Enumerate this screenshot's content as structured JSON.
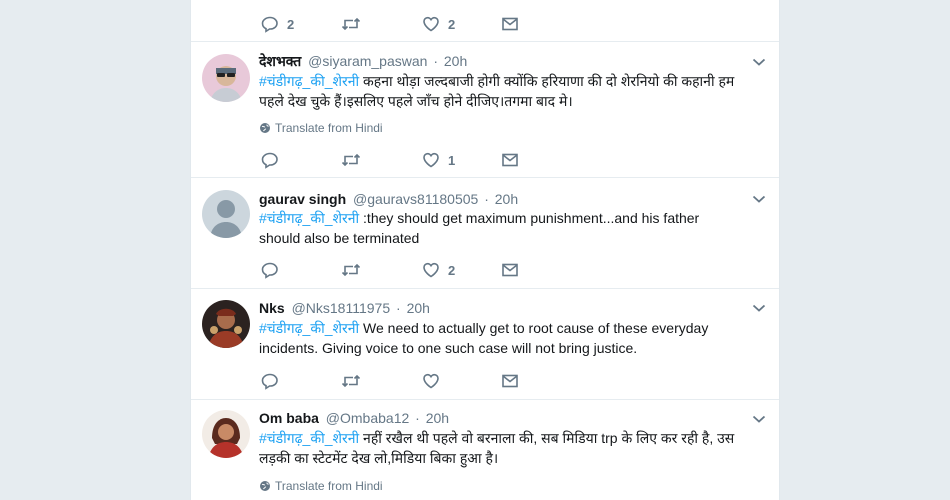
{
  "tweets": [
    {
      "id": "t0",
      "reply_count": "2",
      "retweet_count": "",
      "like_count": "2"
    },
    {
      "id": "t1",
      "name": "देशभक्त",
      "handle": "@siyaram_paswan",
      "time": "20h",
      "hashtag": "#चंडीगढ़_की_शेरनी",
      "text": " कहना थोड़ा जल्दबाजी होगी क्योंकि हरियाणा की दो शेरनियो की कहानी हम पहले देख चुके हैं।इसलिए पहले जाँच होने दीजिए।तगमा बाद मे।",
      "translate": "Translate from Hindi",
      "reply_count": "",
      "retweet_count": "",
      "like_count": "1"
    },
    {
      "id": "t2",
      "name": "gaurav singh",
      "handle": "@gauravs81180505",
      "time": "20h",
      "hashtag": "#चंडीगढ़_की_शेरनी",
      "text": " :they should get maximum punishment...and his father should also be terminated",
      "reply_count": "",
      "retweet_count": "",
      "like_count": "2"
    },
    {
      "id": "t3",
      "name": "Nks",
      "handle": "@Nks18111975",
      "time": "20h",
      "hashtag": "#चंडीगढ़_की_शेरनी",
      "text": " We need to actually get to root cause of these everyday incidents. Giving voice to one such case will not bring justice.",
      "reply_count": "",
      "retweet_count": "",
      "like_count": ""
    },
    {
      "id": "t4",
      "name": "Om baba",
      "handle": "@Ombaba12",
      "time": "20h",
      "hashtag": "#चंडीगढ़_की_शेरनी",
      "text": " नहीं रखैल थी पहले वो बरनाला की, सब मिडिया trp के लिए कर रही है, उस लड़की का स्टेटमेंट देख लो,मिडिया बिका हुआ है।",
      "translate": "Translate from Hindi"
    }
  ],
  "separator": "·",
  "icons": {
    "reply": "reply-icon",
    "retweet": "retweet-icon",
    "like": "heart-icon",
    "message": "envelope-icon",
    "globe": "globe-icon",
    "caret": "chevron-down-icon"
  },
  "colors": {
    "hashtag": "#1da1f2",
    "muted": "#657786",
    "background": "#e6ecf0"
  }
}
